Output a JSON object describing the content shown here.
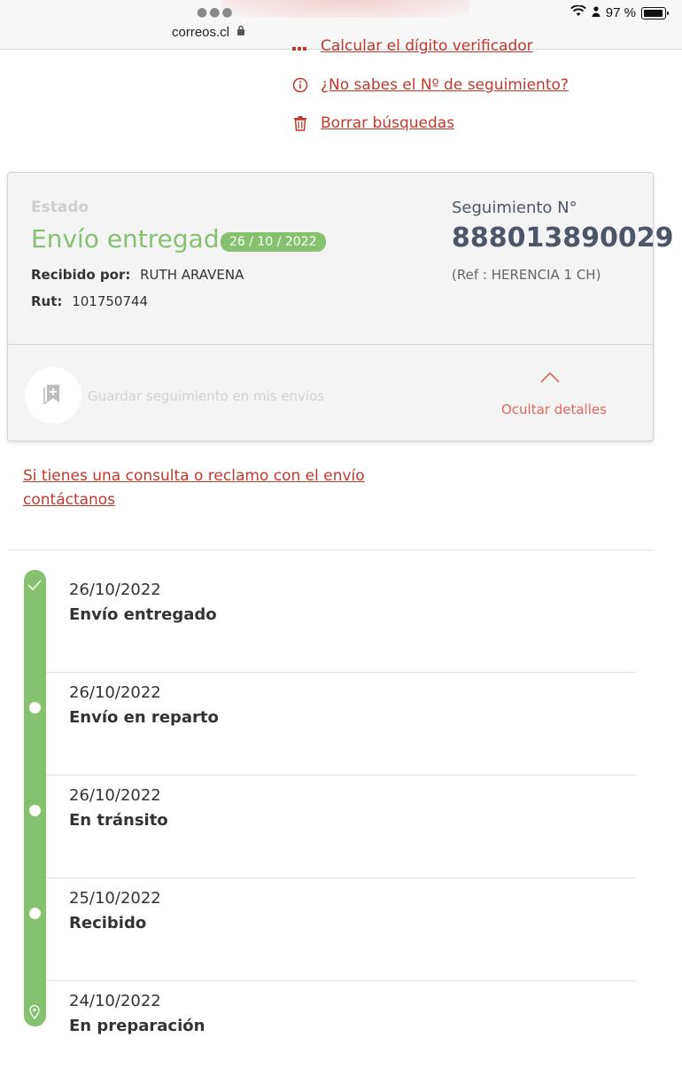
{
  "browser": {
    "url": "correos.cl",
    "battery": "97 %"
  },
  "links": {
    "calculate": "Calcular el dígito verificador",
    "no_tracking": "¿No sabes el Nº de seguimiento?",
    "clear": "Borrar búsquedas"
  },
  "card": {
    "estado_label": "Estado",
    "status": "Envío entregado",
    "date": "26 / 10 / 2022",
    "received_label": "Recibido por:",
    "received_value": "RUTH ARAVENA",
    "rut_label": "Rut:",
    "rut_value": "101750744",
    "tracking_label": "Seguimiento N°",
    "tracking_number": "888013890029",
    "ref": "(Ref : HERENCIA 1 CH)",
    "save_text": "Guardar seguimiento en mis envíos",
    "hide_details": "Ocultar detalles"
  },
  "contact": {
    "line1": "Si tienes una consulta o reclamo con el envío",
    "line2": "contáctanos"
  },
  "timeline": [
    {
      "date": "26/10/2022",
      "status": "Envío entregado",
      "icon": "check-icon"
    },
    {
      "date": "26/10/2022",
      "status": "Envío en reparto",
      "icon": "dot"
    },
    {
      "date": "26/10/2022",
      "status": "En tránsito",
      "icon": "dot"
    },
    {
      "date": "25/10/2022",
      "status": "Recibido",
      "icon": "dot"
    },
    {
      "date": "24/10/2022",
      "status": "En preparación",
      "icon": "location-pin-icon"
    }
  ],
  "colors": {
    "accent_red": "#c0392b",
    "success_green": "#86c170",
    "tracking_text": "#4d5568"
  }
}
